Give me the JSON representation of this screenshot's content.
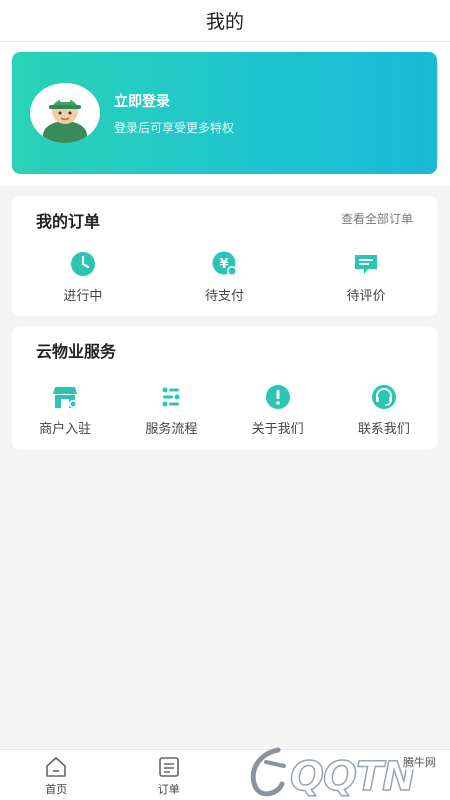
{
  "header": {
    "title": "我的"
  },
  "login": {
    "title": "立即登录",
    "subtitle": "登录后可享受更多特权",
    "avatar_icon": "worker-avatar-icon"
  },
  "orders": {
    "title": "我的订单",
    "view_all": "查看全部订单",
    "items": [
      {
        "label": "进行中",
        "icon": "clock-icon"
      },
      {
        "label": "待支付",
        "icon": "yen-payment-icon"
      },
      {
        "label": "待评价",
        "icon": "comment-icon"
      }
    ]
  },
  "services": {
    "title": "云物业服务",
    "items": [
      {
        "label": "商户入驻",
        "icon": "storefront-icon"
      },
      {
        "label": "服务流程",
        "icon": "process-flow-icon"
      },
      {
        "label": "关于我们",
        "icon": "info-exclamation-icon"
      },
      {
        "label": "联系我们",
        "icon": "headset-icon"
      }
    ]
  },
  "tabbar": {
    "items": [
      {
        "label": "首页",
        "icon": "home-icon"
      },
      {
        "label": "订单",
        "icon": "order-list-icon"
      }
    ]
  },
  "watermark": {
    "brand": "QQTN",
    "site": "腾牛网"
  },
  "colors": {
    "accent": "#2ac5b3",
    "gradient_start": "#2ad2b6",
    "gradient_end": "#19b9d8"
  }
}
